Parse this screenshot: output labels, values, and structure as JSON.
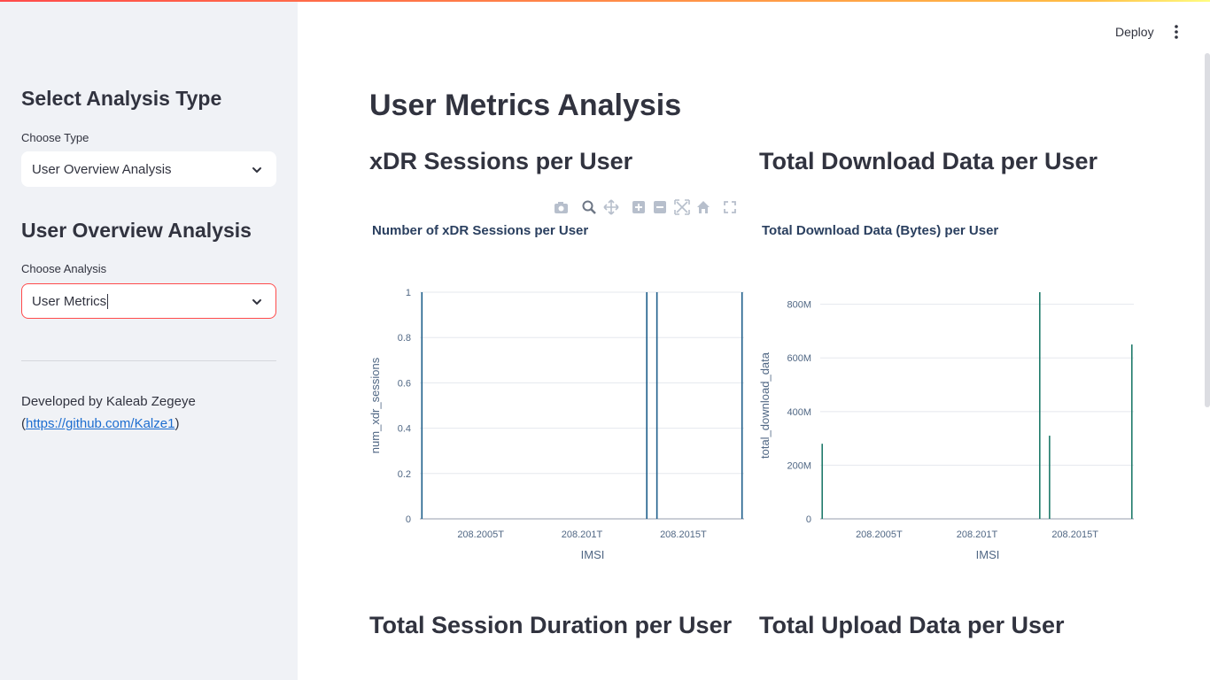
{
  "sidebar": {
    "heading1": "Select Analysis Type",
    "type_label": "Choose Type",
    "type_value": "User Overview Analysis",
    "heading2": "User Overview Analysis",
    "analysis_label": "Choose Analysis",
    "analysis_value": "User Metrics",
    "credit_text": "Developed by Kaleab Zegeye",
    "credit_open": "(",
    "credit_link": "https://github.com/Kalze1",
    "credit_close": ")"
  },
  "header": {
    "deploy_label": "Deploy",
    "menu_icon": "kebab-menu-icon"
  },
  "main": {
    "title": "User Metrics Analysis",
    "sections": [
      "xDR Sessions per User",
      "Total Download Data per User",
      "Total Session Duration per User",
      "Total Upload Data per User"
    ]
  },
  "modebar_icons": [
    "camera-icon",
    "zoom-icon",
    "pan-icon",
    "zoom-in-icon",
    "zoom-out-icon",
    "autoscale-icon",
    "reset-axes-icon",
    "fullscreen-icon"
  ],
  "colors": {
    "accent": "#ff4b4b",
    "bar": "#1f5f8b",
    "bar2": "#1f7a6a",
    "sidebar_bg": "#f0f2f6",
    "link": "#1c6dd0"
  },
  "chart_data": [
    {
      "type": "bar",
      "title": "Number of xDR Sessions per User",
      "xlabel": "IMSI",
      "ylabel": "num_xdr_sessions",
      "x_tick_labels": [
        "208.2005T",
        "208.201T",
        "208.2015T"
      ],
      "x_ticks": [
        0.2005,
        0.201,
        0.2015
      ],
      "xlim": [
        0.2002,
        0.2018
      ],
      "ylim": [
        0,
        1
      ],
      "y_ticks": [
        0,
        0.2,
        0.4,
        0.6,
        0.8,
        1
      ],
      "y_tick_labels": [
        "0",
        "0.2",
        "0.4",
        "0.6",
        "0.8",
        "1"
      ],
      "x": [
        0.20021,
        0.20132,
        0.20137,
        0.20179
      ],
      "values": [
        1,
        1,
        1,
        1
      ],
      "grid": true
    },
    {
      "type": "bar",
      "title": "Total Download Data (Bytes) per User",
      "xlabel": "IMSI",
      "ylabel": "total_download_data",
      "x_tick_labels": [
        "208.2005T",
        "208.201T",
        "208.2015T"
      ],
      "x_ticks": [
        0.2005,
        0.201,
        0.2015
      ],
      "xlim": [
        0.2002,
        0.2018
      ],
      "ylim": [
        0,
        845000000
      ],
      "y_ticks": [
        0,
        200000000,
        400000000,
        600000000,
        800000000
      ],
      "y_tick_labels": [
        "0",
        "200M",
        "400M",
        "600M",
        "800M"
      ],
      "x": [
        0.20021,
        0.20132,
        0.20137,
        0.20179
      ],
      "values": [
        280000000,
        845000000,
        310000000,
        650000000
      ],
      "grid": true
    }
  ]
}
